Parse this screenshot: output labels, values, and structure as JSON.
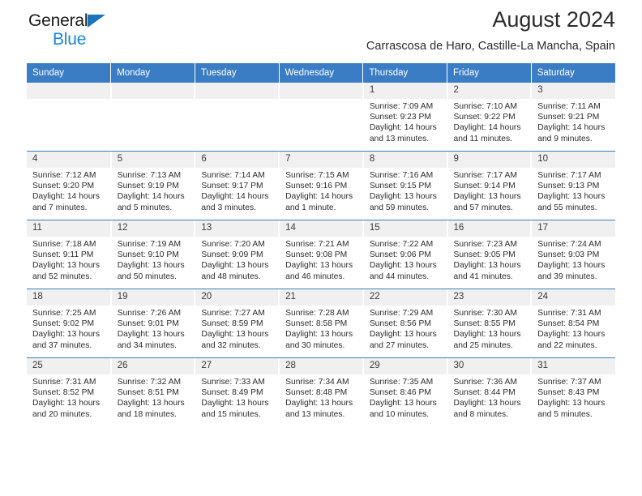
{
  "brand": {
    "name_part1": "General",
    "name_part2": "Blue",
    "triangle_icon": "triangle-icon",
    "accent_color": "#1a86d9",
    "triangle_color": "#1a74bb"
  },
  "header": {
    "title": "August 2024",
    "subtitle": "Carrascosa de Haro, Castille-La Mancha, Spain"
  },
  "theme": {
    "header_row_color": "#3b7dc4",
    "daynum_band_color": "#f0f0f0",
    "text_color": "#2c2c2c"
  },
  "weekdays": [
    "Sunday",
    "Monday",
    "Tuesday",
    "Wednesday",
    "Thursday",
    "Friday",
    "Saturday"
  ],
  "weeks": [
    [
      {
        "day": "",
        "sunrise": "",
        "sunset": "",
        "daylight1": "",
        "daylight2": ""
      },
      {
        "day": "",
        "sunrise": "",
        "sunset": "",
        "daylight1": "",
        "daylight2": ""
      },
      {
        "day": "",
        "sunrise": "",
        "sunset": "",
        "daylight1": "",
        "daylight2": ""
      },
      {
        "day": "",
        "sunrise": "",
        "sunset": "",
        "daylight1": "",
        "daylight2": ""
      },
      {
        "day": "1",
        "sunrise": "Sunrise: 7:09 AM",
        "sunset": "Sunset: 9:23 PM",
        "daylight1": "Daylight: 14 hours",
        "daylight2": "and 13 minutes."
      },
      {
        "day": "2",
        "sunrise": "Sunrise: 7:10 AM",
        "sunset": "Sunset: 9:22 PM",
        "daylight1": "Daylight: 14 hours",
        "daylight2": "and 11 minutes."
      },
      {
        "day": "3",
        "sunrise": "Sunrise: 7:11 AM",
        "sunset": "Sunset: 9:21 PM",
        "daylight1": "Daylight: 14 hours",
        "daylight2": "and 9 minutes."
      }
    ],
    [
      {
        "day": "4",
        "sunrise": "Sunrise: 7:12 AM",
        "sunset": "Sunset: 9:20 PM",
        "daylight1": "Daylight: 14 hours",
        "daylight2": "and 7 minutes."
      },
      {
        "day": "5",
        "sunrise": "Sunrise: 7:13 AM",
        "sunset": "Sunset: 9:19 PM",
        "daylight1": "Daylight: 14 hours",
        "daylight2": "and 5 minutes."
      },
      {
        "day": "6",
        "sunrise": "Sunrise: 7:14 AM",
        "sunset": "Sunset: 9:17 PM",
        "daylight1": "Daylight: 14 hours",
        "daylight2": "and 3 minutes."
      },
      {
        "day": "7",
        "sunrise": "Sunrise: 7:15 AM",
        "sunset": "Sunset: 9:16 PM",
        "daylight1": "Daylight: 14 hours",
        "daylight2": "and 1 minute."
      },
      {
        "day": "8",
        "sunrise": "Sunrise: 7:16 AM",
        "sunset": "Sunset: 9:15 PM",
        "daylight1": "Daylight: 13 hours",
        "daylight2": "and 59 minutes."
      },
      {
        "day": "9",
        "sunrise": "Sunrise: 7:17 AM",
        "sunset": "Sunset: 9:14 PM",
        "daylight1": "Daylight: 13 hours",
        "daylight2": "and 57 minutes."
      },
      {
        "day": "10",
        "sunrise": "Sunrise: 7:17 AM",
        "sunset": "Sunset: 9:13 PM",
        "daylight1": "Daylight: 13 hours",
        "daylight2": "and 55 minutes."
      }
    ],
    [
      {
        "day": "11",
        "sunrise": "Sunrise: 7:18 AM",
        "sunset": "Sunset: 9:11 PM",
        "daylight1": "Daylight: 13 hours",
        "daylight2": "and 52 minutes."
      },
      {
        "day": "12",
        "sunrise": "Sunrise: 7:19 AM",
        "sunset": "Sunset: 9:10 PM",
        "daylight1": "Daylight: 13 hours",
        "daylight2": "and 50 minutes."
      },
      {
        "day": "13",
        "sunrise": "Sunrise: 7:20 AM",
        "sunset": "Sunset: 9:09 PM",
        "daylight1": "Daylight: 13 hours",
        "daylight2": "and 48 minutes."
      },
      {
        "day": "14",
        "sunrise": "Sunrise: 7:21 AM",
        "sunset": "Sunset: 9:08 PM",
        "daylight1": "Daylight: 13 hours",
        "daylight2": "and 46 minutes."
      },
      {
        "day": "15",
        "sunrise": "Sunrise: 7:22 AM",
        "sunset": "Sunset: 9:06 PM",
        "daylight1": "Daylight: 13 hours",
        "daylight2": "and 44 minutes."
      },
      {
        "day": "16",
        "sunrise": "Sunrise: 7:23 AM",
        "sunset": "Sunset: 9:05 PM",
        "daylight1": "Daylight: 13 hours",
        "daylight2": "and 41 minutes."
      },
      {
        "day": "17",
        "sunrise": "Sunrise: 7:24 AM",
        "sunset": "Sunset: 9:03 PM",
        "daylight1": "Daylight: 13 hours",
        "daylight2": "and 39 minutes."
      }
    ],
    [
      {
        "day": "18",
        "sunrise": "Sunrise: 7:25 AM",
        "sunset": "Sunset: 9:02 PM",
        "daylight1": "Daylight: 13 hours",
        "daylight2": "and 37 minutes."
      },
      {
        "day": "19",
        "sunrise": "Sunrise: 7:26 AM",
        "sunset": "Sunset: 9:01 PM",
        "daylight1": "Daylight: 13 hours",
        "daylight2": "and 34 minutes."
      },
      {
        "day": "20",
        "sunrise": "Sunrise: 7:27 AM",
        "sunset": "Sunset: 8:59 PM",
        "daylight1": "Daylight: 13 hours",
        "daylight2": "and 32 minutes."
      },
      {
        "day": "21",
        "sunrise": "Sunrise: 7:28 AM",
        "sunset": "Sunset: 8:58 PM",
        "daylight1": "Daylight: 13 hours",
        "daylight2": "and 30 minutes."
      },
      {
        "day": "22",
        "sunrise": "Sunrise: 7:29 AM",
        "sunset": "Sunset: 8:56 PM",
        "daylight1": "Daylight: 13 hours",
        "daylight2": "and 27 minutes."
      },
      {
        "day": "23",
        "sunrise": "Sunrise: 7:30 AM",
        "sunset": "Sunset: 8:55 PM",
        "daylight1": "Daylight: 13 hours",
        "daylight2": "and 25 minutes."
      },
      {
        "day": "24",
        "sunrise": "Sunrise: 7:31 AM",
        "sunset": "Sunset: 8:54 PM",
        "daylight1": "Daylight: 13 hours",
        "daylight2": "and 22 minutes."
      }
    ],
    [
      {
        "day": "25",
        "sunrise": "Sunrise: 7:31 AM",
        "sunset": "Sunset: 8:52 PM",
        "daylight1": "Daylight: 13 hours",
        "daylight2": "and 20 minutes."
      },
      {
        "day": "26",
        "sunrise": "Sunrise: 7:32 AM",
        "sunset": "Sunset: 8:51 PM",
        "daylight1": "Daylight: 13 hours",
        "daylight2": "and 18 minutes."
      },
      {
        "day": "27",
        "sunrise": "Sunrise: 7:33 AM",
        "sunset": "Sunset: 8:49 PM",
        "daylight1": "Daylight: 13 hours",
        "daylight2": "and 15 minutes."
      },
      {
        "day": "28",
        "sunrise": "Sunrise: 7:34 AM",
        "sunset": "Sunset: 8:48 PM",
        "daylight1": "Daylight: 13 hours",
        "daylight2": "and 13 minutes."
      },
      {
        "day": "29",
        "sunrise": "Sunrise: 7:35 AM",
        "sunset": "Sunset: 8:46 PM",
        "daylight1": "Daylight: 13 hours",
        "daylight2": "and 10 minutes."
      },
      {
        "day": "30",
        "sunrise": "Sunrise: 7:36 AM",
        "sunset": "Sunset: 8:44 PM",
        "daylight1": "Daylight: 13 hours",
        "daylight2": "and 8 minutes."
      },
      {
        "day": "31",
        "sunrise": "Sunrise: 7:37 AM",
        "sunset": "Sunset: 8:43 PM",
        "daylight1": "Daylight: 13 hours",
        "daylight2": "and 5 minutes."
      }
    ]
  ]
}
